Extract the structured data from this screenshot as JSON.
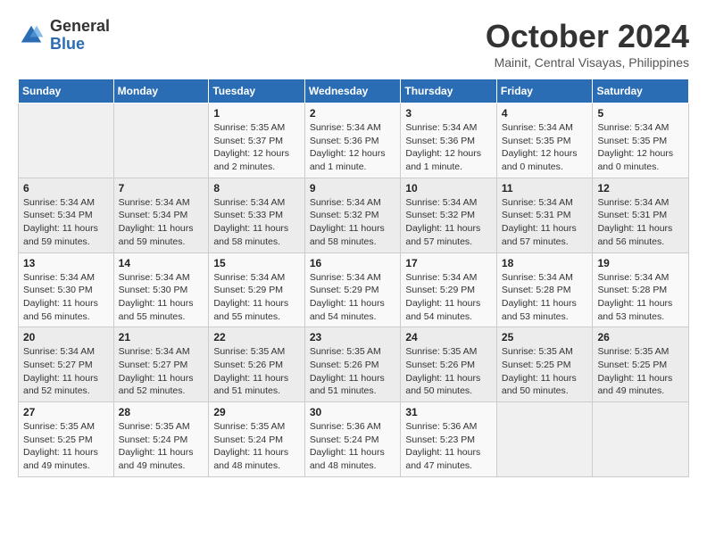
{
  "logo": {
    "general": "General",
    "blue": "Blue"
  },
  "title": "October 2024",
  "location": "Mainit, Central Visayas, Philippines",
  "weekdays": [
    "Sunday",
    "Monday",
    "Tuesday",
    "Wednesday",
    "Thursday",
    "Friday",
    "Saturday"
  ],
  "weeks": [
    [
      {
        "day": "",
        "info": ""
      },
      {
        "day": "",
        "info": ""
      },
      {
        "day": "1",
        "info": "Sunrise: 5:35 AM\nSunset: 5:37 PM\nDaylight: 12 hours\nand 2 minutes."
      },
      {
        "day": "2",
        "info": "Sunrise: 5:34 AM\nSunset: 5:36 PM\nDaylight: 12 hours\nand 1 minute."
      },
      {
        "day": "3",
        "info": "Sunrise: 5:34 AM\nSunset: 5:36 PM\nDaylight: 12 hours\nand 1 minute."
      },
      {
        "day": "4",
        "info": "Sunrise: 5:34 AM\nSunset: 5:35 PM\nDaylight: 12 hours\nand 0 minutes."
      },
      {
        "day": "5",
        "info": "Sunrise: 5:34 AM\nSunset: 5:35 PM\nDaylight: 12 hours\nand 0 minutes."
      }
    ],
    [
      {
        "day": "6",
        "info": "Sunrise: 5:34 AM\nSunset: 5:34 PM\nDaylight: 11 hours\nand 59 minutes."
      },
      {
        "day": "7",
        "info": "Sunrise: 5:34 AM\nSunset: 5:34 PM\nDaylight: 11 hours\nand 59 minutes."
      },
      {
        "day": "8",
        "info": "Sunrise: 5:34 AM\nSunset: 5:33 PM\nDaylight: 11 hours\nand 58 minutes."
      },
      {
        "day": "9",
        "info": "Sunrise: 5:34 AM\nSunset: 5:32 PM\nDaylight: 11 hours\nand 58 minutes."
      },
      {
        "day": "10",
        "info": "Sunrise: 5:34 AM\nSunset: 5:32 PM\nDaylight: 11 hours\nand 57 minutes."
      },
      {
        "day": "11",
        "info": "Sunrise: 5:34 AM\nSunset: 5:31 PM\nDaylight: 11 hours\nand 57 minutes."
      },
      {
        "day": "12",
        "info": "Sunrise: 5:34 AM\nSunset: 5:31 PM\nDaylight: 11 hours\nand 56 minutes."
      }
    ],
    [
      {
        "day": "13",
        "info": "Sunrise: 5:34 AM\nSunset: 5:30 PM\nDaylight: 11 hours\nand 56 minutes."
      },
      {
        "day": "14",
        "info": "Sunrise: 5:34 AM\nSunset: 5:30 PM\nDaylight: 11 hours\nand 55 minutes."
      },
      {
        "day": "15",
        "info": "Sunrise: 5:34 AM\nSunset: 5:29 PM\nDaylight: 11 hours\nand 55 minutes."
      },
      {
        "day": "16",
        "info": "Sunrise: 5:34 AM\nSunset: 5:29 PM\nDaylight: 11 hours\nand 54 minutes."
      },
      {
        "day": "17",
        "info": "Sunrise: 5:34 AM\nSunset: 5:29 PM\nDaylight: 11 hours\nand 54 minutes."
      },
      {
        "day": "18",
        "info": "Sunrise: 5:34 AM\nSunset: 5:28 PM\nDaylight: 11 hours\nand 53 minutes."
      },
      {
        "day": "19",
        "info": "Sunrise: 5:34 AM\nSunset: 5:28 PM\nDaylight: 11 hours\nand 53 minutes."
      }
    ],
    [
      {
        "day": "20",
        "info": "Sunrise: 5:34 AM\nSunset: 5:27 PM\nDaylight: 11 hours\nand 52 minutes."
      },
      {
        "day": "21",
        "info": "Sunrise: 5:34 AM\nSunset: 5:27 PM\nDaylight: 11 hours\nand 52 minutes."
      },
      {
        "day": "22",
        "info": "Sunrise: 5:35 AM\nSunset: 5:26 PM\nDaylight: 11 hours\nand 51 minutes."
      },
      {
        "day": "23",
        "info": "Sunrise: 5:35 AM\nSunset: 5:26 PM\nDaylight: 11 hours\nand 51 minutes."
      },
      {
        "day": "24",
        "info": "Sunrise: 5:35 AM\nSunset: 5:26 PM\nDaylight: 11 hours\nand 50 minutes."
      },
      {
        "day": "25",
        "info": "Sunrise: 5:35 AM\nSunset: 5:25 PM\nDaylight: 11 hours\nand 50 minutes."
      },
      {
        "day": "26",
        "info": "Sunrise: 5:35 AM\nSunset: 5:25 PM\nDaylight: 11 hours\nand 49 minutes."
      }
    ],
    [
      {
        "day": "27",
        "info": "Sunrise: 5:35 AM\nSunset: 5:25 PM\nDaylight: 11 hours\nand 49 minutes."
      },
      {
        "day": "28",
        "info": "Sunrise: 5:35 AM\nSunset: 5:24 PM\nDaylight: 11 hours\nand 49 minutes."
      },
      {
        "day": "29",
        "info": "Sunrise: 5:35 AM\nSunset: 5:24 PM\nDaylight: 11 hours\nand 48 minutes."
      },
      {
        "day": "30",
        "info": "Sunrise: 5:36 AM\nSunset: 5:24 PM\nDaylight: 11 hours\nand 48 minutes."
      },
      {
        "day": "31",
        "info": "Sunrise: 5:36 AM\nSunset: 5:23 PM\nDaylight: 11 hours\nand 47 minutes."
      },
      {
        "day": "",
        "info": ""
      },
      {
        "day": "",
        "info": ""
      }
    ]
  ]
}
